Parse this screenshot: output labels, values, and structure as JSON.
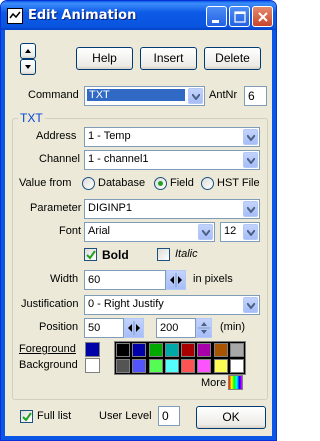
{
  "window": {
    "title": "Edit Animation"
  },
  "toolbar": {
    "help_label": "Help",
    "insert_label": "Insert",
    "delete_label": "Delete"
  },
  "command": {
    "label": "Command",
    "value": "TXT",
    "antnr_label": "AntNr",
    "antnr_value": "6"
  },
  "txt_group": {
    "title": "TXT",
    "address_label": "Address",
    "address_value": "1 - Temp",
    "channel_label": "Channel",
    "channel_value": "1 - channel1",
    "value_from_label": "Value from",
    "value_from_options": [
      "Database",
      "Field",
      "HST File"
    ],
    "value_from_selected": "Field",
    "parameter_label": "Parameter",
    "parameter_value": "DIGINP1",
    "font_label": "Font",
    "font_value": "Arial",
    "font_size": "12",
    "bold_label": "Bold",
    "bold_checked": true,
    "italic_label": "Italic",
    "italic_checked": false,
    "width_label": "Width",
    "width_value": "60",
    "width_unit": "in pixels",
    "justification_label": "Justification",
    "justification_value": "0 - Right Justify",
    "position_label": "Position",
    "position_x": "50",
    "position_y": "200",
    "position_unit": "(min)",
    "foreground_label": "Foreground",
    "background_label": "Background",
    "foreground_color": "#0000a8",
    "background_color": "#ffffff",
    "palette": [
      "#000000",
      "#0000a8",
      "#00a800",
      "#00a8a8",
      "#a80000",
      "#a800a8",
      "#a85400",
      "#a8a8a8",
      "#545454",
      "#5454fc",
      "#54fc54",
      "#54fcfc",
      "#fc5454",
      "#fc54fc",
      "#fcfc54",
      "#ffffff"
    ],
    "more_label": "More"
  },
  "footer": {
    "full_list_label": "Full list",
    "full_list_checked": true,
    "user_level_label": "User Level",
    "user_level_value": "0",
    "ok_label": "OK"
  }
}
